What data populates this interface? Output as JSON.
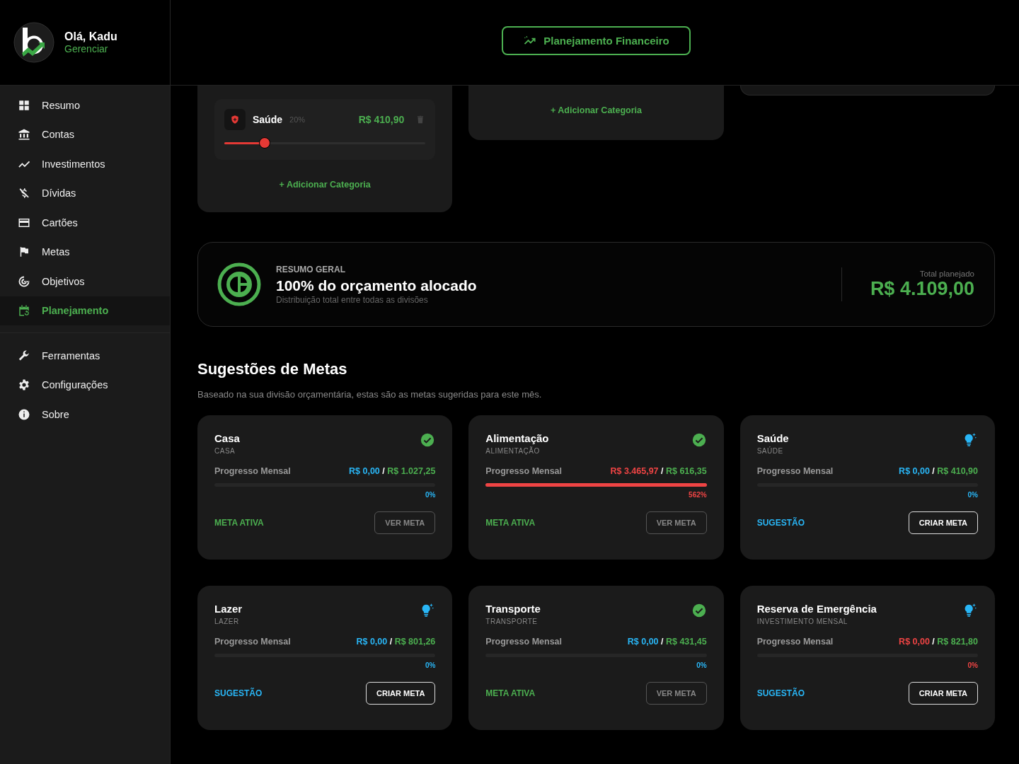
{
  "profile": {
    "greeting": "Olá, Kadu",
    "link": "Gerenciar"
  },
  "nav_groups": [
    [
      {
        "label": "Resumo",
        "selected": false
      },
      {
        "label": "Contas",
        "selected": false
      },
      {
        "label": "Investimentos",
        "selected": false
      },
      {
        "label": "Dívidas",
        "selected": false
      },
      {
        "label": "Cartões",
        "selected": false
      },
      {
        "label": "Metas",
        "selected": false
      },
      {
        "label": "Objetivos",
        "selected": false
      },
      {
        "label": "Planejamento",
        "selected": true
      }
    ],
    [
      {
        "label": "Ferramentas",
        "selected": false
      },
      {
        "label": "Configurações",
        "selected": false
      },
      {
        "label": "Sobre",
        "selected": false
      }
    ]
  ],
  "header": {
    "button": "Planejamento Financeiro"
  },
  "division_cards": [
    {
      "categories": [
        {
          "name": "Saúde",
          "percent": "20%",
          "amount": "R$ 410,90",
          "level": 0.2
        }
      ],
      "add_label": "+ Adicionar Categoria"
    },
    {
      "add_label": "+ Adicionar Categoria"
    }
  ],
  "summary": {
    "eyebrow": "RESUMO GERAL",
    "title": "100% do orçamento alocado",
    "subtitle": "Distribuição total entre todas as divisões",
    "total_label": "Total planejado",
    "total": "R$ 4.109,00"
  },
  "suggestions": {
    "title": "Sugestões de Metas",
    "subtitle": "Baseado na sua divisão orçamentária, estas são as metas sugeridas para este mês.",
    "cards": [
      {
        "title": "Casa",
        "category": "CASA",
        "kind": "active",
        "progress_label": "Progresso Mensal",
        "current": "R$ 0,00",
        "separator": "/",
        "target": "R$ 1.027,25",
        "alert": false,
        "level": 0,
        "percent": "0%",
        "status": "META ATIVA",
        "button": "VER META"
      },
      {
        "title": "Alimentação",
        "category": "ALIMENTAÇÃO",
        "kind": "active",
        "progress_label": "Progresso Mensal",
        "current": "R$ 3.465,97",
        "separator": "/",
        "target": "R$ 616,35",
        "alert": true,
        "level": 1,
        "percent": "562%",
        "status": "META ATIVA",
        "button": "VER META"
      },
      {
        "title": "Saúde",
        "category": "SAÚDE",
        "kind": "suggestion",
        "progress_label": "Progresso Mensal",
        "current": "R$ 0,00",
        "separator": "/",
        "target": "R$ 410,90",
        "alert": false,
        "level": 0,
        "percent": "0%",
        "status": "SUGESTÃO",
        "button": "CRIAR META"
      },
      {
        "title": "Lazer",
        "category": "LAZER",
        "kind": "suggestion",
        "progress_label": "Progresso Mensal",
        "current": "R$ 0,00",
        "separator": "/",
        "target": "R$ 801,26",
        "alert": false,
        "level": 0,
        "percent": "0%",
        "status": "SUGESTÃO",
        "button": "CRIAR META"
      },
      {
        "title": "Transporte",
        "category": "TRANSPORTE",
        "kind": "active",
        "progress_label": "Progresso Mensal",
        "current": "R$ 0,00",
        "separator": "/",
        "target": "R$ 431,45",
        "alert": false,
        "level": 0,
        "percent": "0%",
        "status": "META ATIVA",
        "button": "VER META"
      },
      {
        "title": "Reserva de Emergência",
        "category": "INVESTIMENTO MENSAL",
        "kind": "suggestion",
        "progress_label": "Progresso Mensal",
        "current": "R$ 0,00",
        "separator": "/",
        "target": "R$ 821,80",
        "alert": true,
        "level": 0,
        "percent": "0%",
        "status": "SUGESTÃO",
        "button": "CRIAR META"
      }
    ]
  }
}
